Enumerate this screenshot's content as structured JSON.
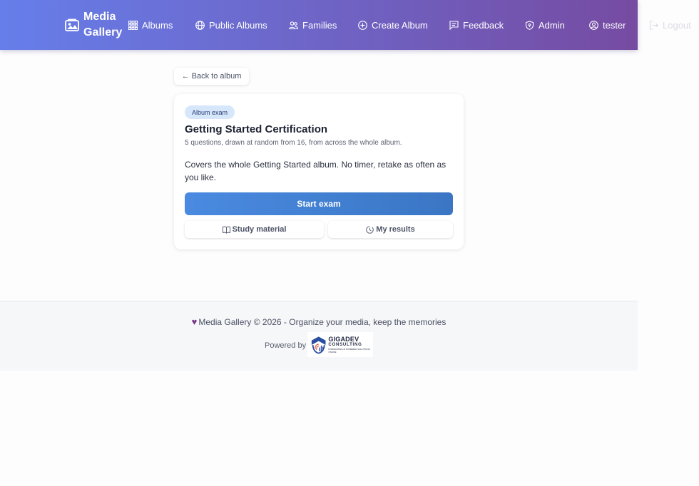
{
  "navbar": {
    "brand": "Media Gallery",
    "items": [
      {
        "label": "Albums",
        "icon": "grid-icon"
      },
      {
        "label": "Public Albums",
        "icon": "globe-icon"
      },
      {
        "label": "Families",
        "icon": "people-icon"
      },
      {
        "label": "Create Album",
        "icon": "plus-circle-icon"
      },
      {
        "label": "Feedback",
        "icon": "chat-icon"
      },
      {
        "label": "Admin",
        "icon": "shield-icon"
      },
      {
        "label": "tester",
        "icon": "user-circle-icon"
      },
      {
        "label": "Logout",
        "icon": "logout-icon"
      }
    ],
    "gradient_start": "#667eea",
    "gradient_end": "#764ba2"
  },
  "back_button": {
    "label": "← Back to album"
  },
  "exam": {
    "badge": "Album exam",
    "title": "Getting Started Certification",
    "subtitle": "5 questions, drawn at random from 16, from across the whole album.",
    "description": "Covers the whole Getting Started album. No timer, retake as often as you like.",
    "start_label": "Start exam",
    "study_label": "Study material",
    "results_label": "My results",
    "accent": "#4a8ae0"
  },
  "footer": {
    "text": "Media Gallery © 2026 - Organize your media, keep the memories",
    "powered_by": "Powered by",
    "logo_name": "GIGADEV",
    "logo_sub": "CONSULTING",
    "logo_tagline": "INTEGRATING AI POWERED SOLUTIONS ONLINE"
  }
}
